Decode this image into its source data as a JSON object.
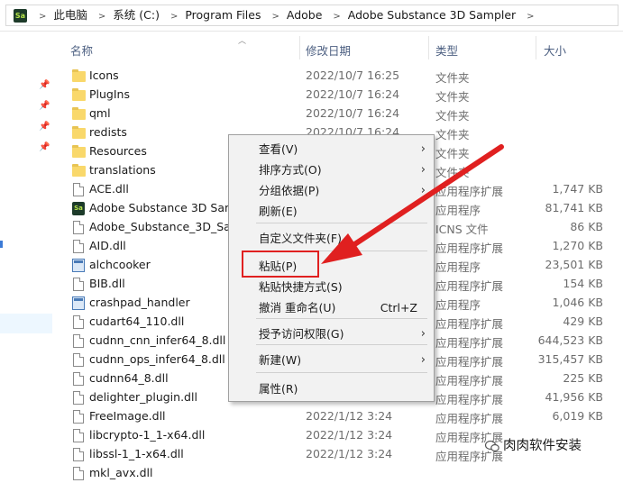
{
  "address": {
    "app_badge": "Sa",
    "crumbs": [
      "此电脑",
      "系统 (C:)",
      "Program Files",
      "Adobe",
      "Adobe Substance 3D Sampler"
    ]
  },
  "columns": {
    "name": "名称",
    "date": "修改日期",
    "type": "类型",
    "size": "大小"
  },
  "files": [
    {
      "name": "Icons",
      "icon": "folder-icon",
      "date": "2022/10/7 16:25",
      "type": "文件夹",
      "size": ""
    },
    {
      "name": "PlugIns",
      "icon": "folder-icon",
      "date": "2022/10/7 16:24",
      "type": "文件夹",
      "size": ""
    },
    {
      "name": "qml",
      "icon": "folder-icon",
      "date": "2022/10/7 16:24",
      "type": "文件夹",
      "size": ""
    },
    {
      "name": "redists",
      "icon": "folder-icon",
      "date": "2022/10/7 16:24",
      "type": "文件夹",
      "size": ""
    },
    {
      "name": "Resources",
      "icon": "folder-icon",
      "date": "",
      "type": "文件夹",
      "size": ""
    },
    {
      "name": "translations",
      "icon": "folder-icon",
      "date": "",
      "type": "文件夹",
      "size": ""
    },
    {
      "name": "ACE.dll",
      "icon": "file-icon",
      "date": "",
      "type": "应用程序扩展",
      "size": "1,747 KB"
    },
    {
      "name": "Adobe Substance 3D Sampler",
      "icon": "sampler-app-icon",
      "date": "",
      "type": "应用程序",
      "size": "81,741 KB"
    },
    {
      "name": "Adobe_Substance_3D_Sampler.icns",
      "icon": "file-icon",
      "date": "",
      "type": "ICNS 文件",
      "size": "86 KB"
    },
    {
      "name": "AID.dll",
      "icon": "file-icon",
      "date": "",
      "type": "应用程序扩展",
      "size": "1,270 KB"
    },
    {
      "name": "alchcooker",
      "icon": "exe-icon",
      "date": "",
      "type": "应用程序",
      "size": "23,501 KB"
    },
    {
      "name": "BIB.dll",
      "icon": "file-icon",
      "date": "",
      "type": "应用程序扩展",
      "size": "154 KB"
    },
    {
      "name": "crashpad_handler",
      "icon": "exe-icon",
      "date": "",
      "type": "应用程序",
      "size": "1,046 KB"
    },
    {
      "name": "cudart64_110.dll",
      "icon": "file-icon",
      "date": "",
      "type": "应用程序扩展",
      "size": "429 KB"
    },
    {
      "name": "cudnn_cnn_infer64_8.dll",
      "icon": "file-icon",
      "date": "",
      "type": "应用程序扩展",
      "size": "644,523 KB"
    },
    {
      "name": "cudnn_ops_infer64_8.dll",
      "icon": "file-icon",
      "date": "",
      "type": "应用程序扩展",
      "size": "315,457 KB"
    },
    {
      "name": "cudnn64_8.dll",
      "icon": "file-icon",
      "date": "",
      "type": "应用程序扩展",
      "size": "225 KB"
    },
    {
      "name": "delighter_plugin.dll",
      "icon": "file-icon",
      "date": "",
      "type": "应用程序扩展",
      "size": "41,956 KB"
    },
    {
      "name": "FreeImage.dll",
      "icon": "file-icon",
      "date": "2022/1/12 3:24",
      "type": "应用程序扩展",
      "size": "6,019 KB"
    },
    {
      "name": "libcrypto-1_1-x64.dll",
      "icon": "file-icon",
      "date": "2022/1/12 3:24",
      "type": "应用程序扩展",
      "size": ""
    },
    {
      "name": "libssl-1_1-x64.dll",
      "icon": "file-icon",
      "date": "2022/1/12 3:24",
      "type": "应用程序扩展",
      "size": ""
    },
    {
      "name": "mkl_avx.dll",
      "icon": "file-icon",
      "date": "",
      "type": "",
      "size": ""
    }
  ],
  "context_menu": {
    "items": [
      {
        "label": "查看(V)",
        "submenu": true,
        "shortcut": ""
      },
      {
        "label": "排序方式(O)",
        "submenu": true,
        "shortcut": ""
      },
      {
        "label": "分组依据(P)",
        "submenu": true,
        "shortcut": ""
      },
      {
        "label": "刷新(E)",
        "submenu": false,
        "shortcut": ""
      },
      {
        "label": "自定义文件夹(F)...",
        "submenu": false,
        "shortcut": ""
      },
      {
        "label": "粘贴(P)",
        "submenu": false,
        "shortcut": ""
      },
      {
        "label": "粘贴快捷方式(S)",
        "submenu": false,
        "shortcut": ""
      },
      {
        "label": "撤消 重命名(U)",
        "submenu": false,
        "shortcut": "Ctrl+Z"
      },
      {
        "label": "授予访问权限(G)",
        "submenu": true,
        "shortcut": ""
      },
      {
        "label": "新建(W)",
        "submenu": true,
        "shortcut": ""
      },
      {
        "label": "属性(R)",
        "submenu": false,
        "shortcut": ""
      }
    ]
  },
  "annotation": {
    "color": "#e02020"
  },
  "watermark": {
    "text": "肉肉软件安装"
  }
}
